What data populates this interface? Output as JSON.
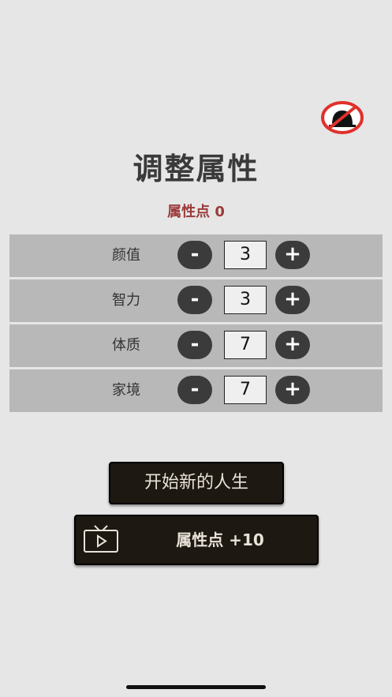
{
  "page": {
    "title": "调整属性",
    "points_label": "属性点 0"
  },
  "no_ads_icon": "no-ads-icon",
  "controls": {
    "minus": "-",
    "plus": "+"
  },
  "attributes": [
    {
      "label": "颜值",
      "value": "3"
    },
    {
      "label": "智力",
      "value": "3"
    },
    {
      "label": "体质",
      "value": "7"
    },
    {
      "label": "家境",
      "value": "7"
    }
  ],
  "buttons": {
    "start": "开始新的人生",
    "ad_reward": "属性点 +10",
    "ad_icon": "tv-icon"
  },
  "colors": {
    "background": "#e6e6e6",
    "row": "#b8b8b8",
    "accent_points": "#9b3a3a",
    "button_dark": "#1e1812",
    "round_button": "#3b3b3b"
  }
}
